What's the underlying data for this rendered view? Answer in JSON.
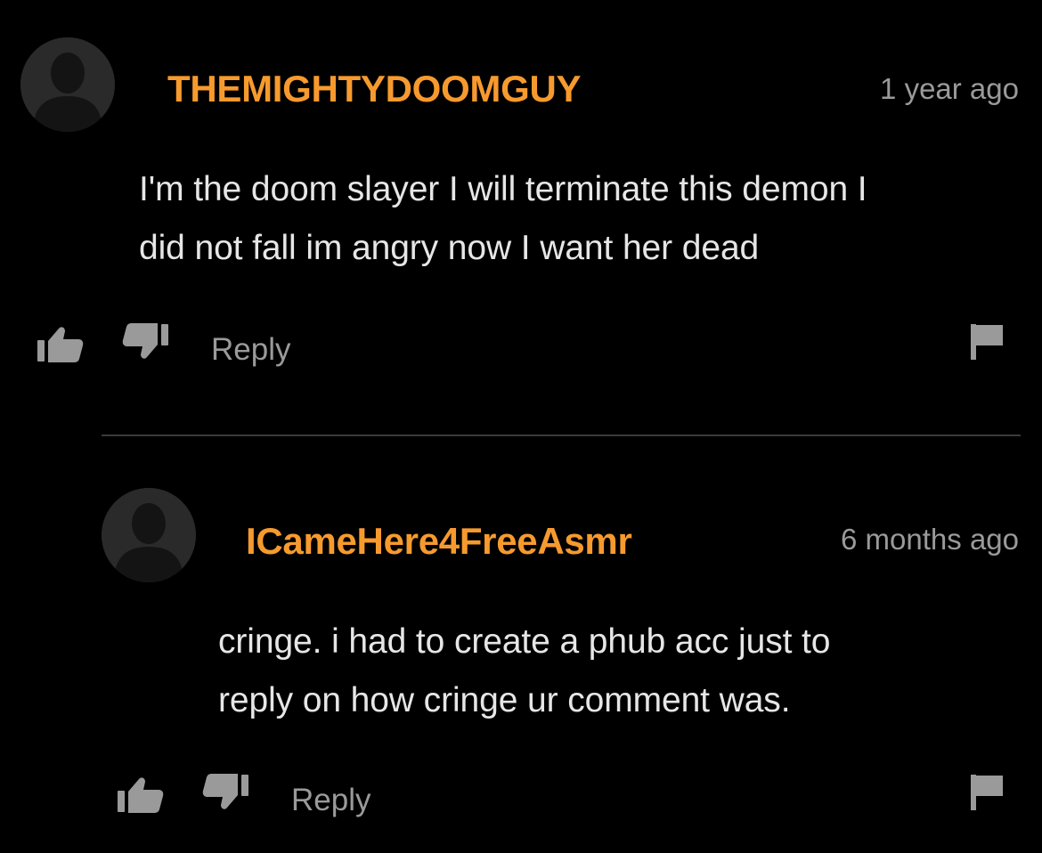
{
  "colors": {
    "background": "#000000",
    "username": "#f79a2e",
    "text": "#e6e6e6",
    "muted": "#9a9a9a",
    "divider": "#3a3a3a"
  },
  "comments": [
    {
      "username": "THEMIGHTYDOOMGUY",
      "timestamp": "1 year ago",
      "text_lines": [
        "I'm the doom slayer I will terminate this demon I",
        "did not fall im angry now I want her dead"
      ],
      "reply_label": "Reply",
      "icons": {
        "avatar": "default-avatar-icon",
        "like": "thumbs-up-icon",
        "dislike": "thumbs-down-icon",
        "flag": "flag-icon"
      }
    },
    {
      "username": "ICameHere4FreeAsmr",
      "timestamp": "6 months ago",
      "text_lines": [
        "cringe. i had to create a phub acc just to",
        "reply on how cringe ur comment was."
      ],
      "reply_label": "Reply",
      "icons": {
        "avatar": "default-avatar-icon",
        "like": "thumbs-up-icon",
        "dislike": "thumbs-down-icon",
        "flag": "flag-icon"
      }
    }
  ]
}
